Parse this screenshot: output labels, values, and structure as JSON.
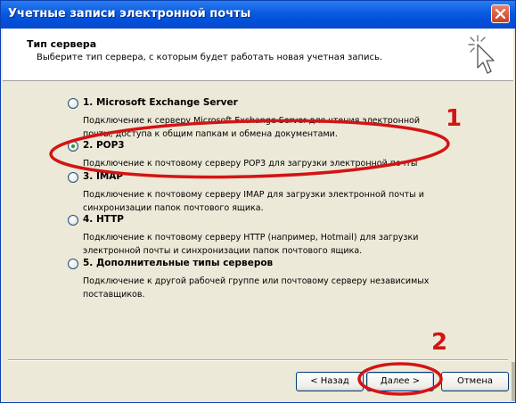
{
  "window": {
    "title": "Учетные записи электронной почты"
  },
  "header": {
    "title": "Тип сервера",
    "subtitle": "Выберите тип сервера, с которым будет работать новая учетная запись."
  },
  "options": [
    {
      "label": "1. Microsoft Exchange Server",
      "description": "Подключение к серверу Microsoft Exchange Server для чтения электронной почты, доступа к общим папкам и обмена документами.",
      "checked": false
    },
    {
      "label": "2. POP3",
      "description": "Подключение к почтовому серверу POP3 для загрузки электронной почты",
      "checked": true
    },
    {
      "label": "3. IMAP",
      "description": "Подключение к почтовому серверу IMAP для загрузки электронной почты и синхронизации папок почтового ящика.",
      "checked": false
    },
    {
      "label": "4. HTTP",
      "description": "Подключение к почтовому серверу HTTP (например, Hotmail) для загрузки электронной почты и синхронизации папок почтового ящика.",
      "checked": false
    },
    {
      "label": "5. Дополнительные типы серверов",
      "description": "Подключение к другой рабочей группе или почтовому серверу независимых поставщиков.",
      "checked": false
    }
  ],
  "buttons": {
    "back": "< Назад",
    "next": "Далее >",
    "cancel": "Отмена"
  },
  "annotations": {
    "marker_1": "1",
    "marker_2": "2",
    "color": "#d41414"
  },
  "icons": {
    "close": "close-icon",
    "wizard": "wizard-cursor-icon"
  }
}
